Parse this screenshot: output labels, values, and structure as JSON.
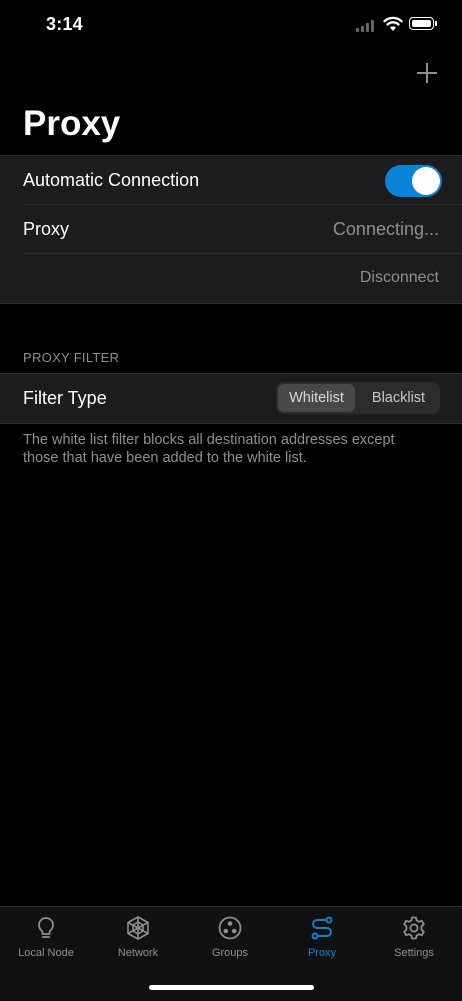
{
  "status_bar": {
    "time": "3:14"
  },
  "header": {
    "title": "Proxy",
    "add_icon": "plus-icon"
  },
  "connection_group": {
    "auto_label": "Automatic Connection",
    "auto_enabled": true,
    "proxy_label": "Proxy",
    "proxy_status": "Connecting...",
    "disconnect_label": "Disconnect"
  },
  "filter_section": {
    "header": "PROXY FILTER",
    "filter_label": "Filter Type",
    "options": [
      "Whitelist",
      "Blacklist"
    ],
    "selected": "Whitelist",
    "footer": "The white list filter blocks all destination addresses except those that have been added to the white list."
  },
  "tabbar": {
    "tabs": [
      {
        "label": "Local Node",
        "icon": "lightbulb-icon",
        "active": false
      },
      {
        "label": "Network",
        "icon": "network-icon",
        "active": false
      },
      {
        "label": "Groups",
        "icon": "groups-icon",
        "active": false
      },
      {
        "label": "Proxy",
        "icon": "proxy-icon",
        "active": true
      },
      {
        "label": "Settings",
        "icon": "gear-icon",
        "active": false
      }
    ]
  },
  "colors": {
    "accent": "#0a84d8",
    "background": "#000000",
    "cell": "#1c1c1e",
    "secondary_text": "#8e8e93"
  }
}
